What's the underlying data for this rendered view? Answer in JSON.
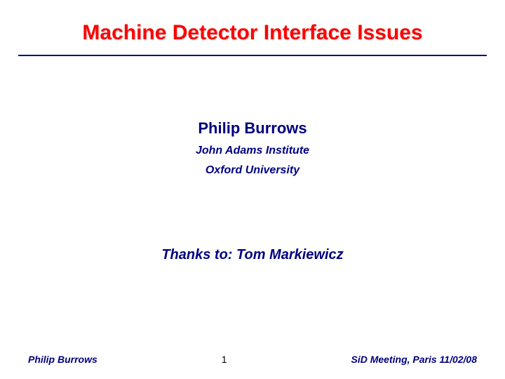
{
  "title": "Machine Detector Interface Issues",
  "author": {
    "name": "Philip Burrows",
    "institute": "John Adams Institute",
    "university": "Oxford University"
  },
  "thanks": "Thanks to: Tom Markiewicz",
  "footer": {
    "left": "Philip Burrows",
    "center": "1",
    "right": "SiD Meeting, Paris   11/02/08"
  }
}
